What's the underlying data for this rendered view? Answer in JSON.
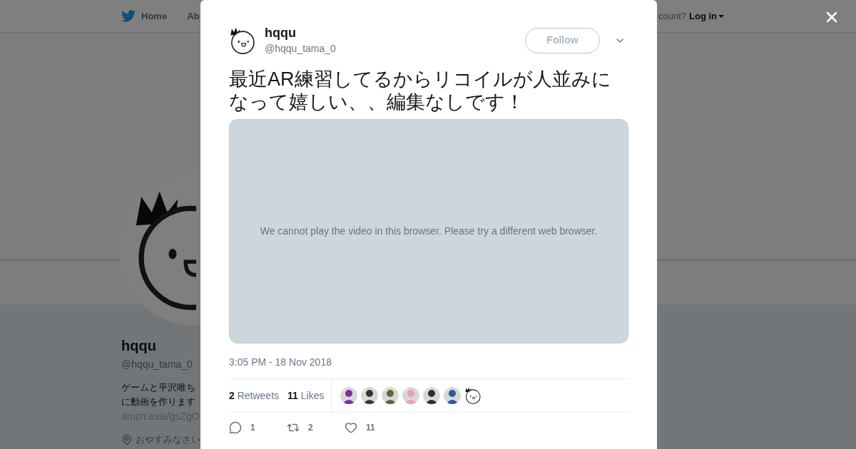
{
  "nav": {
    "items": [
      {
        "label": "Home"
      },
      {
        "label": "Ab"
      }
    ],
    "account_prompt": "count?",
    "login": "Log in"
  },
  "profile": {
    "name": "hqqu",
    "handle": "@hqqu_tama_0",
    "bio": [
      "ゲームと平沢唯ち",
      "に動画を作ります"
    ],
    "link": "amzn.asia/gsZgO",
    "location": "おやすみなさい"
  },
  "tweet": {
    "author": {
      "name": "hqqu",
      "handle": "@hqqu_tama_0"
    },
    "follow_label": "Follow",
    "text": "最近AR練習してるからリコイルが人並みになって嬉しい、、編集なしです！",
    "video_message": "We cannot play the video in this browser. Please try a different web browser.",
    "timestamp": "3:05 PM - 18 Nov 2018",
    "stats": [
      {
        "count": "2",
        "label": "Retweets"
      },
      {
        "count": "11",
        "label": "Likes"
      }
    ],
    "likers": [
      {
        "kind": "picture"
      },
      {
        "kind": "picture"
      },
      {
        "kind": "picture"
      },
      {
        "kind": "picture"
      },
      {
        "kind": "picture"
      },
      {
        "kind": "picture"
      },
      {
        "kind": "face"
      }
    ],
    "actions": [
      {
        "kind": "reply",
        "count": "1"
      },
      {
        "kind": "retweet",
        "count": "2"
      },
      {
        "kind": "like",
        "count": "11"
      }
    ]
  }
}
